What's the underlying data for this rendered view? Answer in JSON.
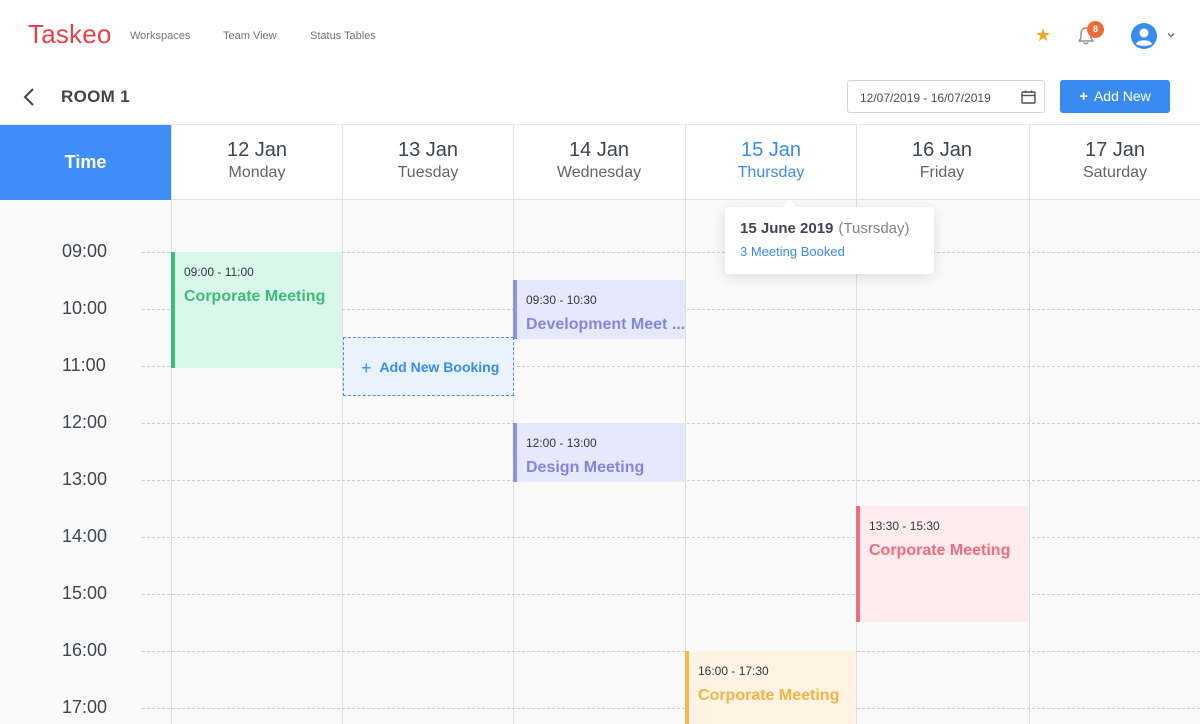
{
  "app": {
    "logo": "Taskeo",
    "nav": [
      "Workspaces",
      "Team View",
      "Status Tables"
    ],
    "notification_count": "8"
  },
  "room": {
    "title": "ROOM 1",
    "date_range": "12/07/2019 - 16/07/2019",
    "add_new_label": "Add New"
  },
  "time_header": "Time",
  "days": [
    {
      "date": "12 Jan",
      "weekday": "Monday"
    },
    {
      "date": "13 Jan",
      "weekday": "Tuesday"
    },
    {
      "date": "14 Jan",
      "weekday": "Wednesday"
    },
    {
      "date": "15 Jan",
      "weekday": "Thursday"
    },
    {
      "date": "16 Jan",
      "weekday": "Friday"
    },
    {
      "date": "17 Jan",
      "weekday": "Saturday"
    }
  ],
  "times": [
    "09:00",
    "10:00",
    "11:00",
    "12:00",
    "13:00",
    "14:00",
    "15:00",
    "16:00",
    "17:00"
  ],
  "events": [
    {
      "time": "09:00 - 11:00",
      "title": "Corporate Meeting",
      "color": "#3bbd7c"
    },
    {
      "time": "09:30 - 10:30",
      "title": "Development Meet ...",
      "color": "#8e8fe6"
    },
    {
      "time": "12:00 - 13:00",
      "title": "Design Meeting",
      "color": "#8e8fe6"
    },
    {
      "time": "13:30 - 15:30",
      "title": "Corporate Meeting",
      "color": "#ef6d7d"
    },
    {
      "time": "16:00 - 17:30",
      "title": "Corporate Meeting",
      "color": "#f5b84e"
    }
  ],
  "add_booking_label": "Add New Booking",
  "tooltip": {
    "date": "15 June 2019",
    "weekday": "(Tusrsday)",
    "count": "3 Meeting Booked"
  },
  "colors": {
    "accent": "#3a8bf0",
    "logo": "#e8414a"
  }
}
